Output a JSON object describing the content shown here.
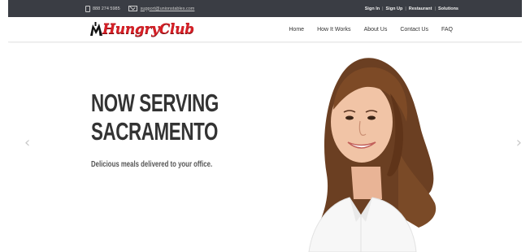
{
  "topbar": {
    "phone": "888 274 5985",
    "email": "support@unionstables.com",
    "links": [
      "Sign In",
      "Sign Up",
      "Restaurant",
      "Solutions"
    ]
  },
  "header": {
    "logo_text": "HungryClub",
    "nav": [
      "Home",
      "How It Works",
      "About Us",
      "Contact Us",
      "FAQ"
    ]
  },
  "hero": {
    "headline_line1": "NOW SERVING",
    "headline_line2": "SACRAMENTO",
    "subline": "Delicious meals delivered to your office.",
    "prev_arrow": "‹",
    "next_arrow": "›"
  },
  "colors": {
    "topbar_bg": "#3a3d44",
    "brand_red": "#d71f26",
    "headline": "#333333"
  }
}
